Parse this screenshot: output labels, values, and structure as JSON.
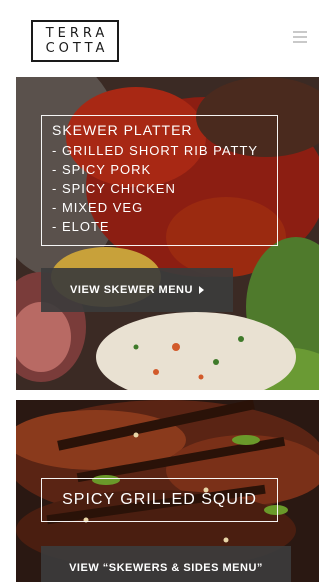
{
  "brand": {
    "logo_line1": "TERRA",
    "logo_line2": "COTTA"
  },
  "header": {
    "menu_icon": "hamburger-menu-icon"
  },
  "cards": [
    {
      "title": "SKEWER PLATTER",
      "items": [
        "- GRILLED SHORT RIB PATTY",
        "- SPICY PORK",
        "- SPICY CHICKEN",
        "- MIXED VEG",
        "- ELOTE"
      ],
      "button_label": "VIEW SKEWER MENU",
      "button_icon": "caret-right-icon"
    },
    {
      "title": "SPICY GRILLED SQUID",
      "button_label": "VIEW “SKEWERS & SIDES MENU”"
    }
  ]
}
